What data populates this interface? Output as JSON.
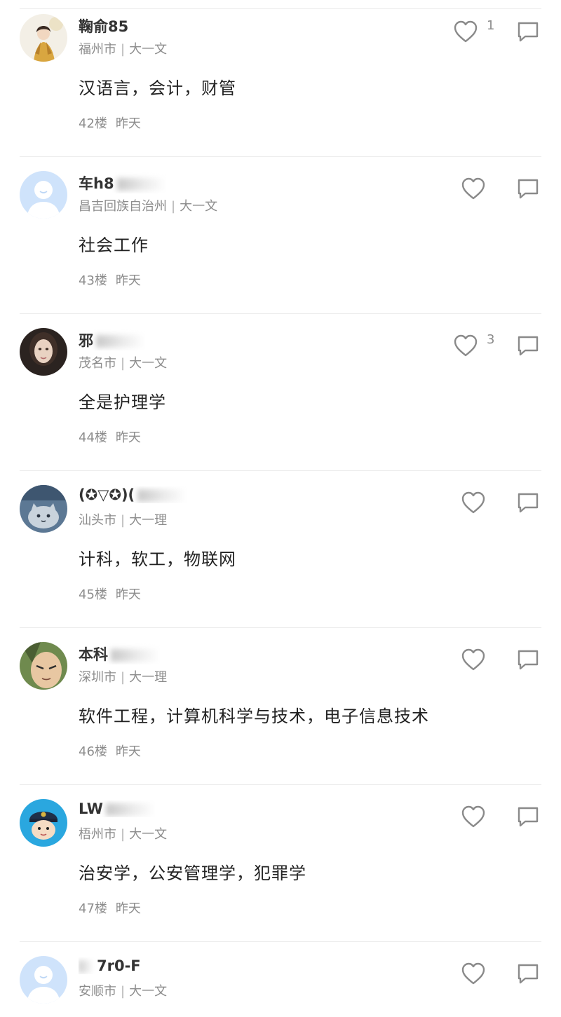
{
  "comments": [
    {
      "username": "鞠俞85",
      "username_redacted": false,
      "location": "福州市",
      "grade": "大一文",
      "text": "汉语言，会计，财管",
      "floor": "42楼",
      "time": "昨天",
      "likes": "1",
      "avatar": "anime-girl-avatar"
    },
    {
      "username": "车h8",
      "username_redacted": true,
      "location": "昌吉回族自治州",
      "grade": "大一文",
      "text": "社会工作",
      "floor": "43楼",
      "time": "昨天",
      "likes": "",
      "avatar": "default-avatar"
    },
    {
      "username": "邪",
      "username_redacted": true,
      "location": "茂名市",
      "grade": "大一文",
      "text": "全是护理学",
      "floor": "44楼",
      "time": "昨天",
      "likes": "3",
      "avatar": "woman-portrait-avatar"
    },
    {
      "username": "(✪▽✪)(",
      "username_redacted": true,
      "location": "汕头市",
      "grade": "大一理",
      "text": "计科，软工，物联网",
      "floor": "45楼",
      "time": "昨天",
      "likes": "",
      "avatar": "cartoon-cat-avatar"
    },
    {
      "username": "本科",
      "username_redacted": true,
      "location": "深圳市",
      "grade": "大一理",
      "text": "软件工程，计算机科学与技术，电子信息技术",
      "floor": "46楼",
      "time": "昨天",
      "likes": "",
      "avatar": "anime-character-avatar"
    },
    {
      "username": "LW",
      "username_redacted": true,
      "location": "梧州市",
      "grade": "大一文",
      "text": "治安学，公安管理学，犯罪学",
      "floor": "47楼",
      "time": "昨天",
      "likes": "",
      "avatar": "police-cartoon-avatar"
    },
    {
      "username": "7r0-F",
      "username_redacted": true,
      "location": "安顺市",
      "grade": "大一文",
      "text": "",
      "floor": "",
      "time": "",
      "likes": "",
      "avatar": "default-avatar"
    }
  ],
  "colors": {
    "meta_text": "#8c8c8c",
    "body_text": "#222222",
    "divider": "#ececec",
    "default_avatar_bg": "#cfe3fb"
  },
  "icons": {
    "like": "heart-outline-icon",
    "reply": "speech-bubble-icon"
  }
}
